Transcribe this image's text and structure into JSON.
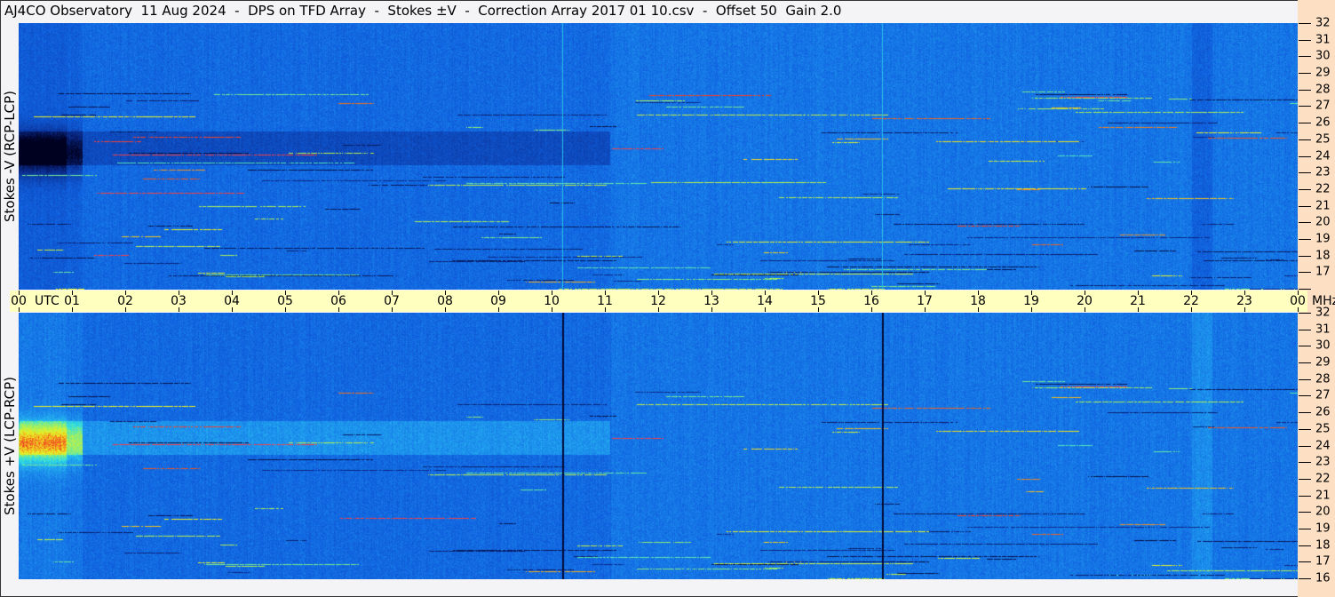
{
  "title": "AJ4CO Observatory  11 Aug 2024  -  DPS on TFD Array  -  Stokes ±V  -  Correction Array 2017 01 10.csv  -  Offset 50  Gain 2.0",
  "chart_data": {
    "type": "heatmap",
    "x_axis": {
      "unit_label": "UTC",
      "range_hours": [
        0,
        24
      ],
      "tick_labels": [
        "00",
        "01",
        "02",
        "03",
        "04",
        "05",
        "06",
        "07",
        "08",
        "09",
        "10",
        "11",
        "12",
        "13",
        "14",
        "15",
        "16",
        "17",
        "18",
        "19",
        "20",
        "21",
        "22",
        "23",
        "00"
      ]
    },
    "y_axis": {
      "unit_label": "MHz",
      "range": [
        16,
        32
      ],
      "tick_labels": [
        "32",
        "31",
        "30",
        "29",
        "28",
        "27",
        "26",
        "25",
        "24",
        "23",
        "22",
        "21",
        "20",
        "19",
        "18",
        "17",
        "16"
      ]
    },
    "panels": [
      {
        "label": "Stokes -V (RCP-LCP)",
        "position": "top",
        "features": {
          "dark_band_mhz": [
            23.5,
            25.5
          ],
          "dark_band_hours": [
            0,
            11.1
          ],
          "vertical_lines_hours": [
            10.2,
            16.2
          ],
          "vertical_line_color": "#40e0e0"
        }
      },
      {
        "label": "Stokes +V (LCP-RCP)",
        "position": "bottom",
        "features": {
          "bright_band_mhz": [
            23.5,
            25.5
          ],
          "bright_band_hours": [
            0,
            11.1
          ],
          "vertical_lines_hours": [
            10.2,
            16.2
          ],
          "vertical_line_color": "#000020"
        }
      }
    ],
    "colormap": [
      "#000020",
      "#0a2a8a",
      "#1060e0",
      "#20a0f0",
      "#30e0e0",
      "#a0f060",
      "#f0f020",
      "#f04020",
      "#ff40ff"
    ]
  },
  "colors": {
    "axis_strip": "#ffffc0",
    "freq_axis_bg": "#fde0c4",
    "title_bg": "#f4f4f6"
  }
}
